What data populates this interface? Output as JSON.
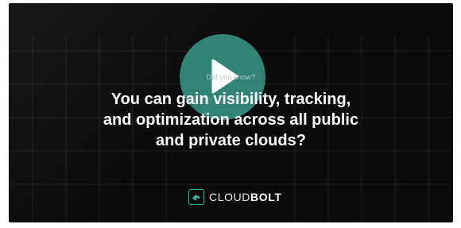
{
  "video": {
    "eyebrow": "Did you know?",
    "headline_lines": [
      "You can gain visibility, tracking,",
      "and optimization across all public",
      "and private clouds?"
    ],
    "brand_light": "CLOUD",
    "brand_bold": "BOLT",
    "play_icon": "play-icon",
    "accent_color": "#40b2a0",
    "background_color": "#0b0b0b"
  }
}
